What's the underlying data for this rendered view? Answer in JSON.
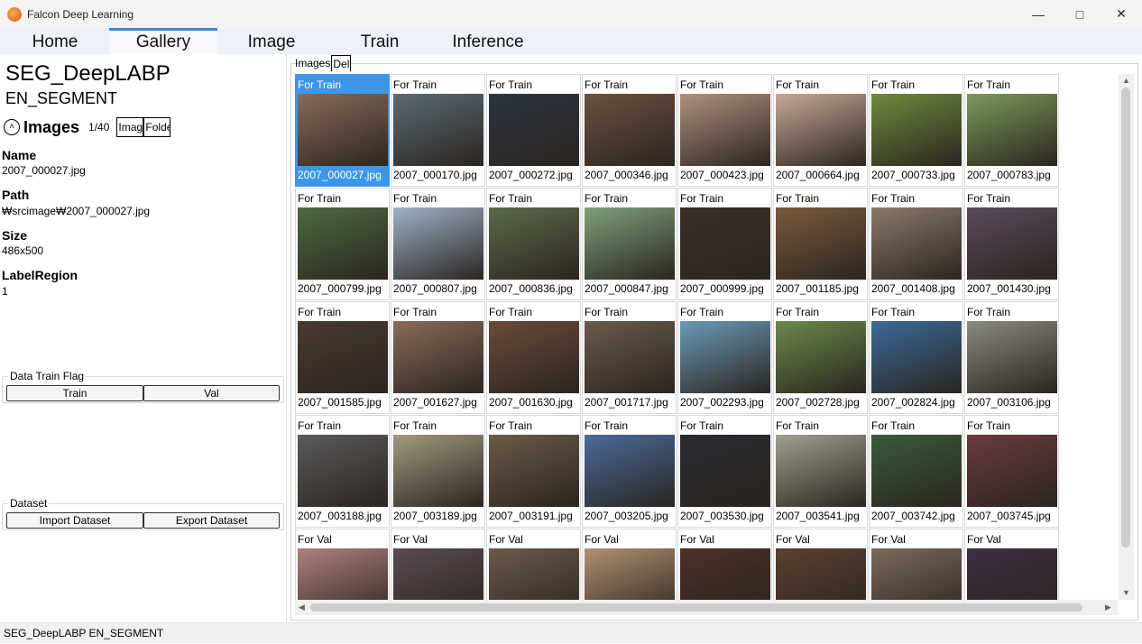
{
  "window": {
    "title": "Falcon Deep Learning"
  },
  "nav": {
    "tabs": [
      "Home",
      "Gallery",
      "Image",
      "Train",
      "Inference"
    ],
    "active": "Gallery"
  },
  "project": {
    "name": "SEG_DeepLABP",
    "type": "EN_SEGMENT"
  },
  "images_section": {
    "title": "Images",
    "count": "1/40",
    "image_button": "Imag",
    "folder_button": "Folde"
  },
  "properties": [
    {
      "label": "Name",
      "value": "2007_000027.jpg"
    },
    {
      "label": "Path",
      "value": "₩srcimage₩2007_000027.jpg"
    },
    {
      "label": "Size",
      "value": "486x500"
    },
    {
      "label": "LabelRegion",
      "value": "1"
    }
  ],
  "data_train_flag": {
    "legend": "Data Train Flag",
    "train": "Train",
    "val": "Val"
  },
  "dataset": {
    "legend": "Dataset",
    "import": "Import Dataset",
    "export": "Export Dataset"
  },
  "statusbar": {
    "text": "SEG_DeepLABP  EN_SEGMENT"
  },
  "gallery_tabs": {
    "images": "Images",
    "del": "Del"
  },
  "gallery": {
    "selected_index": 0,
    "items": [
      {
        "flag": "For Train",
        "file": "2007_000027.jpg",
        "color": "#8a6a5a"
      },
      {
        "flag": "For Train",
        "file": "2007_000170.jpg",
        "color": "#5b6a73"
      },
      {
        "flag": "For Train",
        "file": "2007_000272.jpg",
        "color": "#2c3440"
      },
      {
        "flag": "For Train",
        "file": "2007_000346.jpg",
        "color": "#6b5040"
      },
      {
        "flag": "For Train",
        "file": "2007_000423.jpg",
        "color": "#b09080"
      },
      {
        "flag": "For Train",
        "file": "2007_000664.jpg",
        "color": "#c8a898"
      },
      {
        "flag": "For Train",
        "file": "2007_000733.jpg",
        "color": "#6e8a3c"
      },
      {
        "flag": "For Train",
        "file": "2007_000783.jpg",
        "color": "#7c9a5a"
      },
      {
        "flag": "For Train",
        "file": "2007_000799.jpg",
        "color": "#4d6a3f"
      },
      {
        "flag": "For Train",
        "file": "2007_000807.jpg",
        "color": "#9fb1c8"
      },
      {
        "flag": "For Train",
        "file": "2007_000836.jpg",
        "color": "#5c6a48"
      },
      {
        "flag": "For Train",
        "file": "2007_000847.jpg",
        "color": "#7fa07a"
      },
      {
        "flag": "For Train",
        "file": "2007_000999.jpg",
        "color": "#3a3028"
      },
      {
        "flag": "For Train",
        "file": "2007_001185.jpg",
        "color": "#7a5a3c"
      },
      {
        "flag": "For Train",
        "file": "2007_001408.jpg",
        "color": "#8a7a6a"
      },
      {
        "flag": "For Train",
        "file": "2007_001430.jpg",
        "color": "#5a4a5a"
      },
      {
        "flag": "For Train",
        "file": "2007_001585.jpg",
        "color": "#4a3a30"
      },
      {
        "flag": "For Train",
        "file": "2007_001627.jpg",
        "color": "#8a6a58"
      },
      {
        "flag": "For Train",
        "file": "2007_001630.jpg",
        "color": "#6a4a3a"
      },
      {
        "flag": "For Train",
        "file": "2007_001717.jpg",
        "color": "#6a5a4a"
      },
      {
        "flag": "For Train",
        "file": "2007_002293.jpg",
        "color": "#6a9ab8"
      },
      {
        "flag": "For Train",
        "file": "2007_002728.jpg",
        "color": "#6a8a4a"
      },
      {
        "flag": "For Train",
        "file": "2007_002824.jpg",
        "color": "#3a6a9a"
      },
      {
        "flag": "For Train",
        "file": "2007_003106.jpg",
        "color": "#8a8a80"
      },
      {
        "flag": "For Train",
        "file": "2007_003188.jpg",
        "color": "#5a5a5a"
      },
      {
        "flag": "For Train",
        "file": "2007_003189.jpg",
        "color": "#a09a80"
      },
      {
        "flag": "For Train",
        "file": "2007_003191.jpg",
        "color": "#6a5a48"
      },
      {
        "flag": "For Train",
        "file": "2007_003205.jpg",
        "color": "#4a6a9a"
      },
      {
        "flag": "For Train",
        "file": "2007_003530.jpg",
        "color": "#2a2a30"
      },
      {
        "flag": "For Train",
        "file": "2007_003541.jpg",
        "color": "#a0a090"
      },
      {
        "flag": "For Train",
        "file": "2007_003742.jpg",
        "color": "#3a5a3a"
      },
      {
        "flag": "For Train",
        "file": "2007_003745.jpg",
        "color": "#6a3a40"
      },
      {
        "flag": "For Val",
        "file": "",
        "color": "#b08080"
      },
      {
        "flag": "For Val",
        "file": "",
        "color": "#5a4a50"
      },
      {
        "flag": "For Val",
        "file": "",
        "color": "#6a5a4a"
      },
      {
        "flag": "For Val",
        "file": "",
        "color": "#b09070"
      },
      {
        "flag": "For Val",
        "file": "",
        "color": "#4a3028"
      },
      {
        "flag": "For Val",
        "file": "",
        "color": "#5a4030"
      },
      {
        "flag": "For Val",
        "file": "",
        "color": "#7a6a5a"
      },
      {
        "flag": "For Val",
        "file": "",
        "color": "#3a3040"
      }
    ]
  }
}
